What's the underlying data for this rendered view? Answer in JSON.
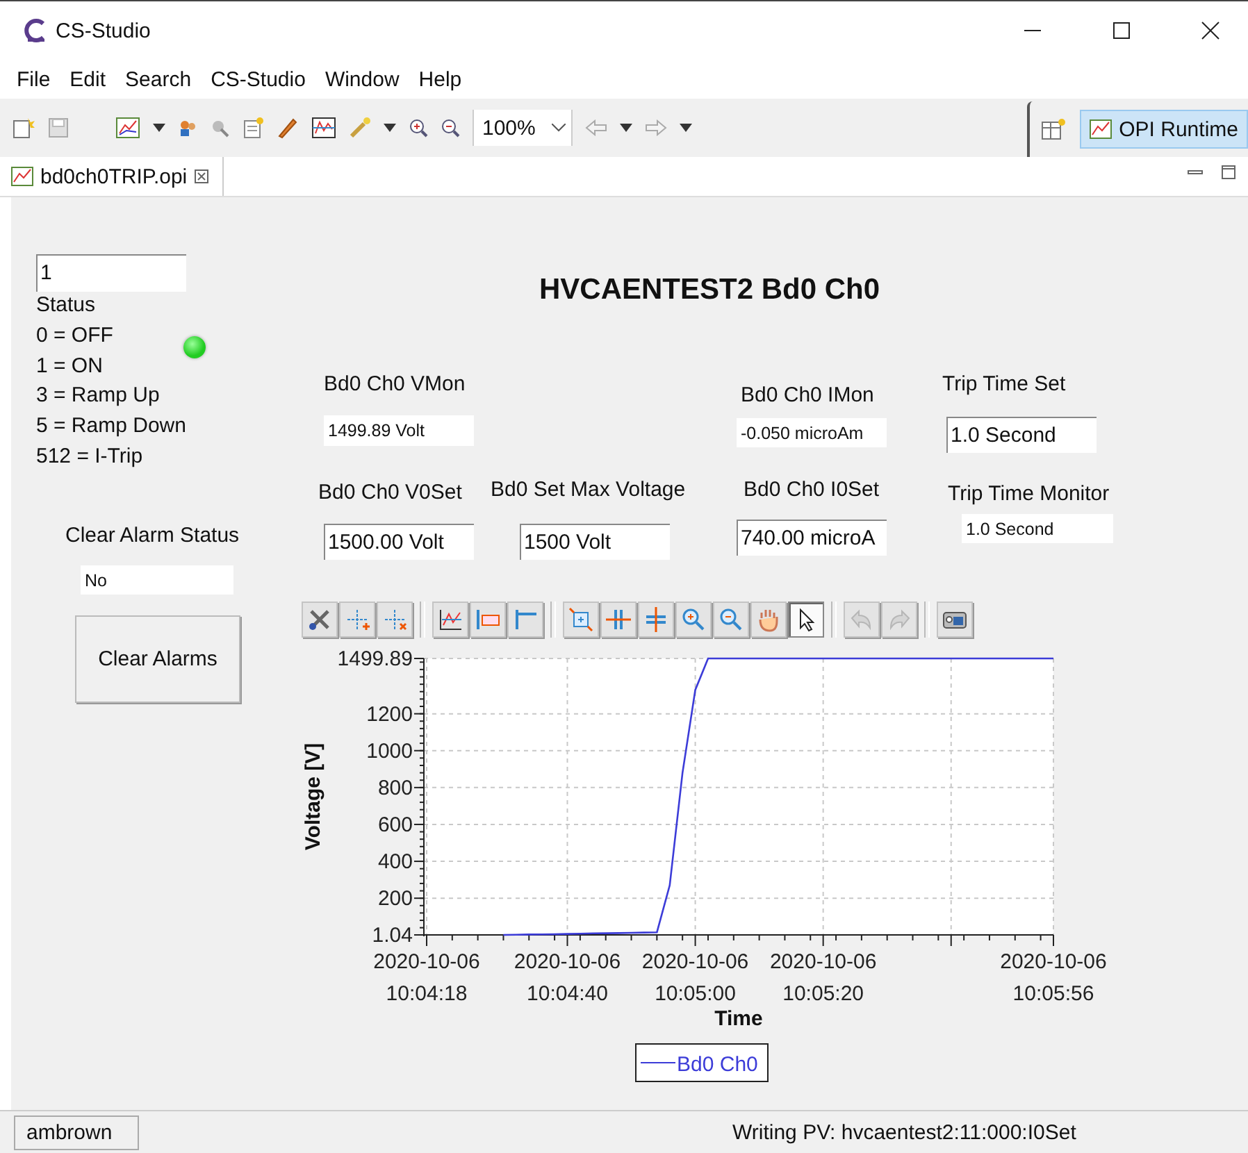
{
  "window": {
    "title": "CS-Studio"
  },
  "menu": [
    "File",
    "Edit",
    "Search",
    "CS-Studio",
    "Window",
    "Help"
  ],
  "toolbar": {
    "zoom": "100%",
    "perspective": {
      "label": "OPI Runtime",
      "selected": true
    }
  },
  "editor_tab": {
    "label": "bd0ch0TRIP.opi",
    "selected": true
  },
  "display": {
    "status_input": "1",
    "status_legend": [
      "Status",
      "0 = OFF",
      "1 = ON",
      "3 = Ramp Up",
      "5 = Ramp Down",
      "512 = I-Trip"
    ],
    "led": {
      "on": true
    },
    "title": "HVCAENTEST2 Bd0 Ch0",
    "widgets": [
      {
        "label": "Bd0 Ch0 VMon",
        "kind": "readout",
        "value": "1499.89 Volt"
      },
      {
        "label": "Bd0 Ch0 IMon",
        "kind": "readout",
        "value": "-0.050 microAm"
      },
      {
        "label": "Trip Time Set",
        "kind": "input",
        "value": "1.0 Second"
      },
      {
        "label": "Bd0 Ch0 V0Set",
        "kind": "input",
        "value": "1500.00 Volt"
      },
      {
        "label": "Bd0 Set Max Voltage",
        "kind": "input",
        "value": "1500 Volt"
      },
      {
        "label": "Bd0 Ch0 I0Set",
        "kind": "input",
        "value": "740.00 microA"
      },
      {
        "label": "Trip Time Monitor",
        "kind": "readout",
        "value": "1.0 Second"
      },
      {
        "label": "Clear Alarm Status",
        "kind": "readout",
        "value": "No"
      }
    ],
    "button": "Clear Alarms",
    "chart_tools": [
      {
        "selected": false,
        "disabled": false
      },
      {
        "selected": false,
        "disabled": false
      },
      {
        "selected": false,
        "disabled": false
      },
      {
        "selected": false,
        "disabled": false
      },
      {
        "selected": false,
        "disabled": false
      },
      {
        "selected": false,
        "disabled": false
      },
      {
        "selected": false,
        "disabled": false
      },
      {
        "selected": false,
        "disabled": false
      },
      {
        "selected": false,
        "disabled": false
      },
      {
        "selected": false,
        "disabled": false
      },
      {
        "selected": false,
        "disabled": false
      },
      {
        "selected": false,
        "disabled": false
      },
      {
        "selected": true,
        "disabled": false
      },
      {
        "selected": false,
        "disabled": true
      },
      {
        "selected": false,
        "disabled": true
      },
      {
        "selected": false,
        "disabled": false
      }
    ],
    "chart": {
      "chart_data": {
        "type": "line",
        "xlabel": "Time",
        "ylabel": "Voltage [V]",
        "categories": [
          "2020-10-06 10:04:18",
          null,
          null,
          null,
          null,
          null,
          null,
          null,
          null,
          null,
          null,
          "2020-10-06 10:04:40",
          null,
          null,
          null,
          null,
          null,
          null,
          null,
          null,
          null,
          "2020-10-06 10:05:00",
          null,
          null,
          null,
          null,
          null,
          null,
          null,
          null,
          null,
          "2020-10-06 10:05:20",
          null,
          null,
          null,
          null,
          null,
          null,
          null,
          null,
          null,
          null,
          null,
          null,
          null,
          null,
          null,
          null,
          null,
          "2020-10-06 10:05:56"
        ],
        "series": [
          {
            "name": "Bd0 Ch0",
            "color": "#3c3cd8",
            "values": [
              null,
              null,
              null,
              null,
              null,
              null,
              1.04,
              2,
              3,
              4,
              5,
              6,
              8,
              9,
              10,
              11,
              12,
              14,
              15,
              270,
              880,
              1330,
              1499.89,
              1499.89,
              1499.89,
              1499.89,
              1499.89,
              1499.89,
              1499.89,
              1499.89,
              1499.89,
              1499.89,
              1499.89,
              1499.89,
              1499.89,
              1499.89,
              1499.89,
              1499.89,
              1499.89,
              1499.89,
              1499.89,
              1499.89,
              1499.89,
              1499.89,
              1499.89,
              1499.89,
              1499.89,
              1499.89,
              1499.89,
              1499.89
            ]
          }
        ],
        "ylim": [
          1.04,
          1499.89
        ],
        "grid": true,
        "yticks": [
          1.04,
          200,
          400,
          600,
          800,
          1000,
          1200,
          1499.89
        ]
      }
    }
  },
  "status_bar": {
    "user": "ambrown",
    "message": "Writing PV: hvcaentest2:11:000:I0Set"
  }
}
